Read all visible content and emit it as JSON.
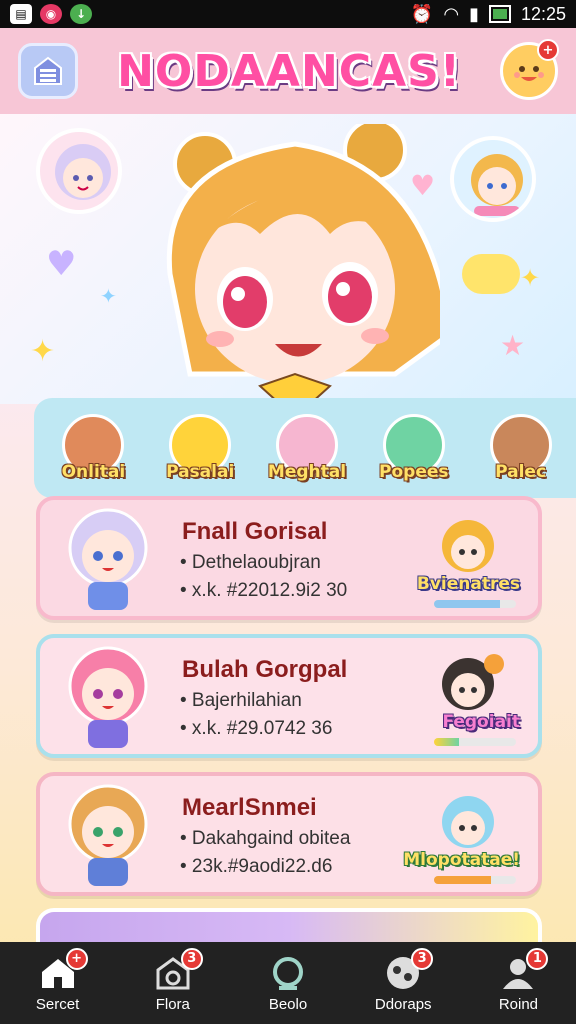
{
  "status_bar": {
    "time": "12:25"
  },
  "header": {
    "title": "NODAANCAS!",
    "profile_badge": "+"
  },
  "categories": [
    {
      "label": "Onlitai",
      "color": "#e08a5b"
    },
    {
      "label": "Pasalai",
      "color": "#ffd33a"
    },
    {
      "label": "Meghtal",
      "color": "#f6b6d0"
    },
    {
      "label": "Popees",
      "color": "#6fd3a3"
    },
    {
      "label": "Palec",
      "color": "#c9875b"
    }
  ],
  "cards": [
    {
      "title": "Fnall Gorisal",
      "line1": "• Dethelaoubjran",
      "line2": "• x.k. #22012.9i2 30",
      "tag": "Bvienatres",
      "progress": 0.8
    },
    {
      "title": "Bulah Gorgpal",
      "line1": "• Bajerhilahian",
      "line2": "• x.k. #29.0742 36",
      "tag": "Fegoiait",
      "progress": 0.3
    },
    {
      "title": "MearlSnmei",
      "line1": "• Dakahgaind obitea",
      "line2": "• 23k.#9aodi22.d6",
      "tag": "Mlopotatae!",
      "progress": 0.7
    }
  ],
  "bottom_nav": [
    {
      "label": "Sercet",
      "badge": "+"
    },
    {
      "label": "Flora",
      "badge": "3"
    },
    {
      "label": "Beolo",
      "badge": ""
    },
    {
      "label": "Ddoraps",
      "badge": "3"
    },
    {
      "label": "Roind",
      "badge": "1"
    }
  ]
}
